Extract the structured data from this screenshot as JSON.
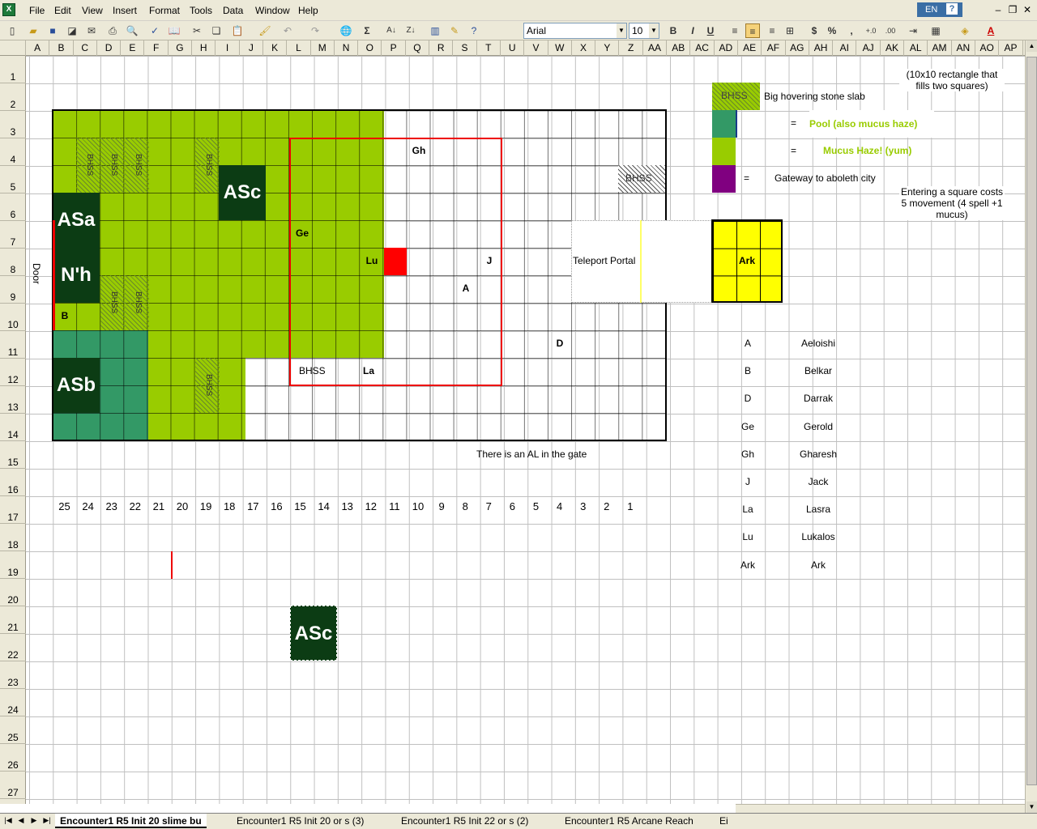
{
  "menubar": {
    "items": [
      "File",
      "Edit",
      "View",
      "Insert",
      "Format",
      "Tools",
      "Data",
      "Window",
      "Help"
    ],
    "lang": "EN",
    "help": "?"
  },
  "toolbar": {
    "font": "Arial",
    "size": "10",
    "bold": "B",
    "italic": "I",
    "underline": "U",
    "currency": "$",
    "percent": "%",
    "comma": ",",
    "sum": "Σ"
  },
  "columns": [
    "A",
    "B",
    "C",
    "D",
    "E",
    "F",
    "G",
    "H",
    "I",
    "J",
    "K",
    "L",
    "M",
    "N",
    "O",
    "P",
    "Q",
    "R",
    "S",
    "T",
    "U",
    "V",
    "W",
    "X",
    "Y",
    "Z",
    "AA",
    "AB",
    "AC",
    "AD",
    "AE",
    "AF",
    "AG",
    "AH",
    "AI",
    "AJ",
    "AK",
    "AL",
    "AM",
    "AN",
    "AO",
    "AP"
  ],
  "rows": [
    "1",
    "2",
    "3",
    "4",
    "5",
    "6",
    "7",
    "8",
    "9",
    "10",
    "11",
    "12",
    "13",
    "14",
    "15",
    "16",
    "17",
    "18",
    "19",
    "20",
    "21",
    "22",
    "23",
    "24",
    "25",
    "26",
    "27"
  ],
  "map": {
    "door": "Door",
    "bhss": "BHSS",
    "tokens": {
      "asa": "ASa",
      "nh": "N'h",
      "asb": "ASb",
      "asc": "ASc",
      "asc2": "ASc",
      "b": "B",
      "ge": "Ge",
      "gh": "Gh",
      "lu": "Lu",
      "j": "J",
      "a": "A",
      "d": "D",
      "la": "La",
      "bhss_label": "BHSS"
    },
    "teleport": "Teleport Portal",
    "gate_note": "There is an AL in the gate",
    "ark": "Ark",
    "bottom_numbers": [
      "25",
      "24",
      "23",
      "22",
      "21",
      "20",
      "19",
      "18",
      "17",
      "16",
      "15",
      "14",
      "13",
      "12",
      "11",
      "10",
      "9",
      "8",
      "7",
      "6",
      "5",
      "4",
      "3",
      "2",
      "1"
    ]
  },
  "legend": {
    "bhss_swatch": "BHSS",
    "bhss_desc": "Big hovering stone slab",
    "bhss_note": "(10x10 rectangle that fills two squares)",
    "eq": "=",
    "pool": "Pool (also mucus haze)",
    "mucus": "Mucus Haze! (yum)",
    "gateway": "Gateway to aboleth city",
    "movement_note": "Entering a square costs 5 movement (4 spell +1 mucus)",
    "colors": {
      "pool": "#339966",
      "mucus": "#99CC00",
      "gateway": "#800080",
      "ark": "#FFFF00",
      "dark": "#0C3C14"
    }
  },
  "roster": [
    {
      "code": "A",
      "name": "Aeloishi"
    },
    {
      "code": "B",
      "name": "Belkar"
    },
    {
      "code": "D",
      "name": "Darrak"
    },
    {
      "code": "Ge",
      "name": "Gerold"
    },
    {
      "code": "Gh",
      "name": "Gharesh"
    },
    {
      "code": "J",
      "name": "Jack"
    },
    {
      "code": "La",
      "name": "Lasra"
    },
    {
      "code": "Lu",
      "name": "Lukalos"
    },
    {
      "code": "Ark",
      "name": "Ark"
    }
  ],
  "sheet_tabs": [
    "Encounter1 R5  Init 20 slime bu",
    "Encounter1 R5  Init 20 or s (3)",
    "Encounter1 R5  Init 22 or s (2)",
    "Encounter1 R5 Arcane Reach",
    "Ei"
  ]
}
